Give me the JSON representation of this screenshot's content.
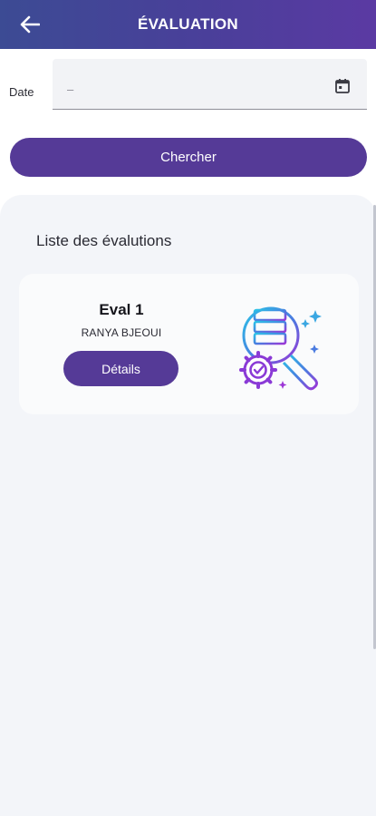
{
  "header": {
    "title": "ÉVALUATION",
    "back_icon": "arrow-left-icon",
    "gradient_start": "#3c4b94",
    "gradient_end": "#5b3aa3"
  },
  "filter": {
    "date_label": "Date",
    "date_value": "–",
    "date_icon": "calendar-icon"
  },
  "search": {
    "label": "Chercher"
  },
  "list": {
    "title": "Liste des évalutions",
    "items": [
      {
        "name": "Eval 1",
        "person": "RANYA BJEOUI",
        "details_label": "Détails",
        "illustration": "database-search-gear-icon"
      }
    ]
  },
  "colors": {
    "accent": "#553a97",
    "panel_background": "#f3f5f9"
  }
}
